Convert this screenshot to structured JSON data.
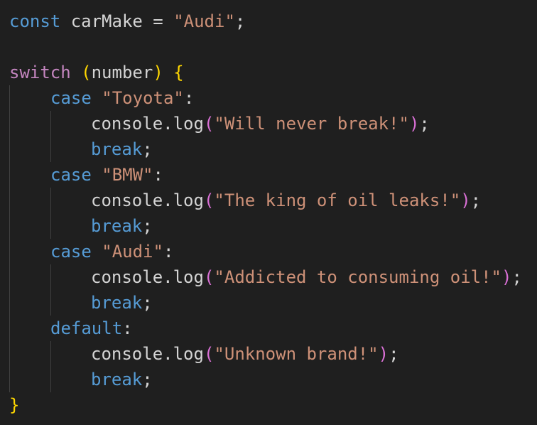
{
  "code": {
    "line1": {
      "kw": "const",
      "rest": " carMake = ",
      "str": "\"Audi\"",
      "end": ";"
    },
    "line3": {
      "kw": "switch",
      "sp": " ",
      "paren_open": "(",
      "expr": "number",
      "paren_close": ")",
      "sp2": " ",
      "brace": "{"
    },
    "cases": [
      {
        "kw": "case",
        "label": "\"Toyota\"",
        "colon": ":",
        "obj": "console",
        "dot": ".",
        "fn": "log",
        "p_open": "(",
        "msg": "\"Will never break!\"",
        "p_close": ")",
        "semi": ";",
        "brk": "break",
        "brk_semi": ";"
      },
      {
        "kw": "case",
        "label": "\"BMW\"",
        "colon": ":",
        "obj": "console",
        "dot": ".",
        "fn": "log",
        "p_open": "(",
        "msg": "\"The king of oil leaks!\"",
        "p_close": ")",
        "semi": ";",
        "brk": "break",
        "brk_semi": ";"
      },
      {
        "kw": "case",
        "label": "\"Audi\"",
        "colon": ":",
        "obj": "console",
        "dot": ".",
        "fn": "log",
        "p_open": "(",
        "msg": "\"Addicted to consuming oil!\"",
        "p_close": ")",
        "semi": ";",
        "brk": "break",
        "brk_semi": ";"
      }
    ],
    "default_case": {
      "kw": "default",
      "colon": ":",
      "obj": "console",
      "dot": ".",
      "fn": "log",
      "p_open": "(",
      "msg": "\"Unknown brand!\"",
      "p_close": ")",
      "semi": ";",
      "brk": "break",
      "brk_semi": ";"
    },
    "closing_brace": "}"
  },
  "colors": {
    "background": "#1f1f1f",
    "keyword": "#569cd6",
    "control": "#c586c0",
    "string": "#ce9178",
    "text": "#d4d4d4",
    "bracket_level1": "#ffd700",
    "bracket_level2": "#da70d6"
  }
}
